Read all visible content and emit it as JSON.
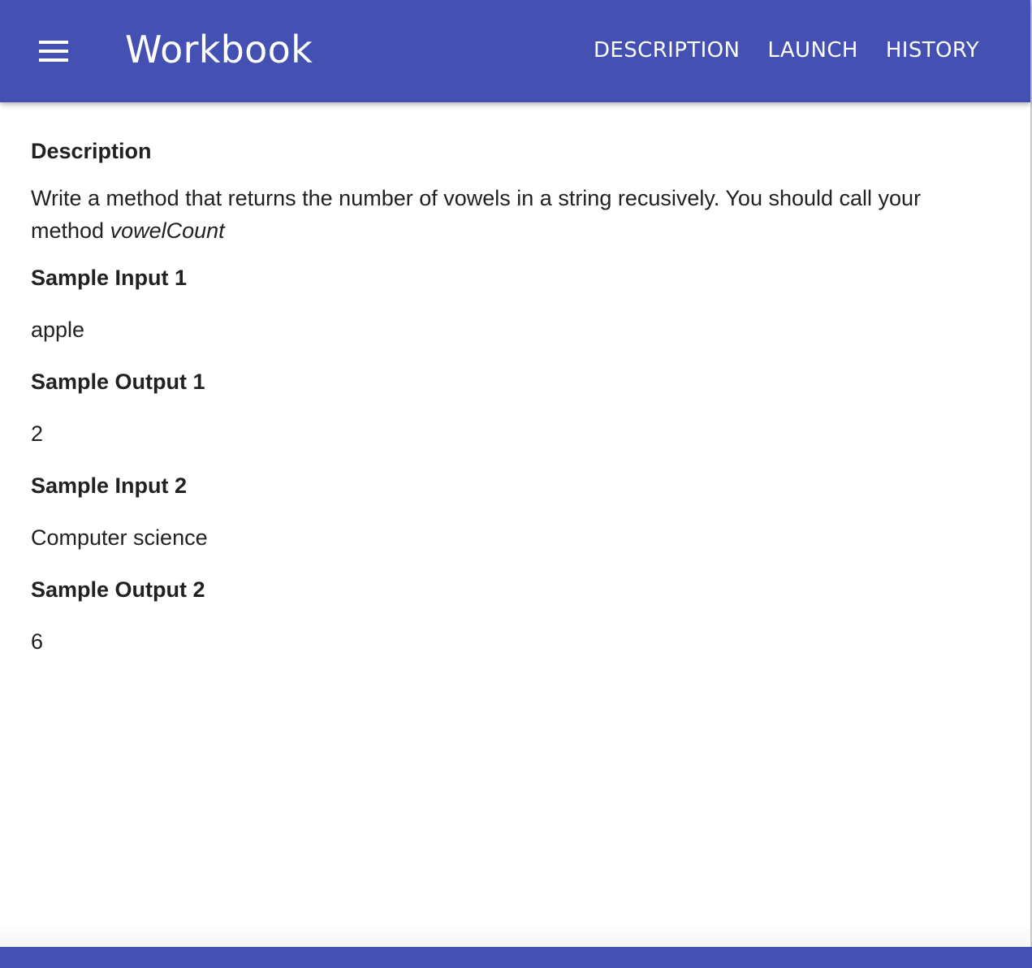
{
  "app_bar": {
    "title": "Workbook",
    "menu_icon": "hamburger-menu-icon",
    "nav": [
      {
        "label": "DESCRIPTION"
      },
      {
        "label": "LAUNCH"
      },
      {
        "label": "HISTORY"
      }
    ],
    "color": "#4451b2"
  },
  "content": {
    "heading": "Description",
    "description_text": "Write a method that returns the number of vowels in a string recusively. You should call your method ",
    "method_name": "vowelCount",
    "samples": [
      {
        "label": "Sample Input 1",
        "value": "apple"
      },
      {
        "label": "Sample Output 1",
        "value": "2"
      },
      {
        "label": "Sample Input 2",
        "value": "Computer science"
      },
      {
        "label": "Sample Output 2",
        "value": "6"
      }
    ]
  }
}
